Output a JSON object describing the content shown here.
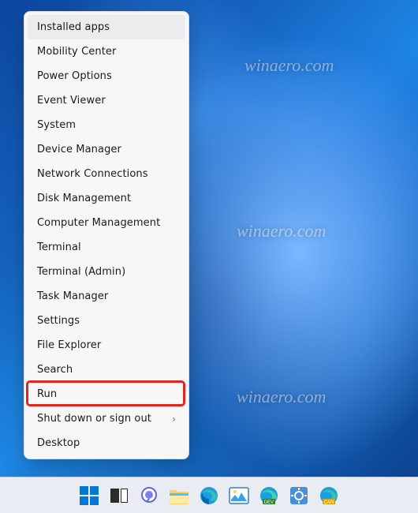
{
  "watermark": "winaero.com",
  "menu": {
    "items": [
      {
        "label": "Installed apps",
        "submenu": false
      },
      {
        "label": "Mobility Center",
        "submenu": false
      },
      {
        "label": "Power Options",
        "submenu": false
      },
      {
        "label": "Event Viewer",
        "submenu": false
      },
      {
        "label": "System",
        "submenu": false
      },
      {
        "label": "Device Manager",
        "submenu": false
      },
      {
        "label": "Network Connections",
        "submenu": false
      },
      {
        "label": "Disk Management",
        "submenu": false
      },
      {
        "label": "Computer Management",
        "submenu": false
      },
      {
        "label": "Terminal",
        "submenu": false
      },
      {
        "label": "Terminal (Admin)",
        "submenu": false
      },
      {
        "label": "Task Manager",
        "submenu": false
      },
      {
        "label": "Settings",
        "submenu": false
      },
      {
        "label": "File Explorer",
        "submenu": false
      },
      {
        "label": "Search",
        "submenu": false
      },
      {
        "label": "Run",
        "submenu": false
      },
      {
        "label": "Shut down or sign out",
        "submenu": true
      },
      {
        "label": "Desktop",
        "submenu": false
      }
    ],
    "hovered_index": 0,
    "highlighted_index": 15,
    "chevron_glyph": "›"
  },
  "taskbar": {
    "icons": [
      {
        "name": "start-icon"
      },
      {
        "name": "taskview-icon"
      },
      {
        "name": "chat-icon"
      },
      {
        "name": "file-explorer-icon"
      },
      {
        "name": "edge-icon"
      },
      {
        "name": "photos-icon"
      },
      {
        "name": "edge-dev-icon"
      },
      {
        "name": "settings-alt-icon"
      },
      {
        "name": "edge-canary-icon"
      }
    ]
  }
}
